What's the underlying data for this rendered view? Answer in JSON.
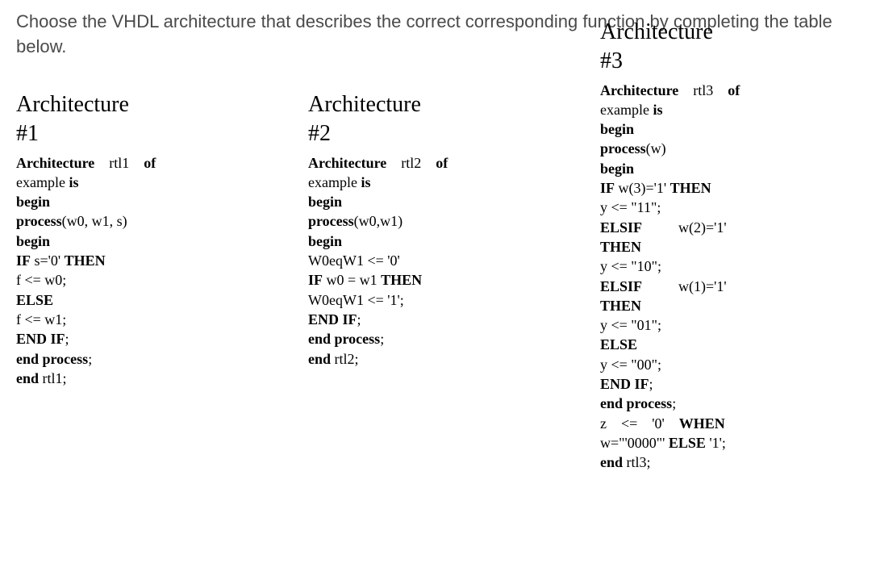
{
  "question": "Choose the VHDL architecture that describes the correct corresponding function by completing the table below.",
  "architectures": [
    {
      "title": "Architecture",
      "number": "#1",
      "lines": [
        {
          "parts": [
            {
              "t": "Architecture",
              "b": true
            },
            {
              "t": "    rtl1    "
            },
            {
              "t": "of",
              "b": true
            }
          ]
        },
        {
          "parts": [
            {
              "t": "example "
            },
            {
              "t": "is",
              "b": true
            }
          ]
        },
        {
          "parts": [
            {
              "t": "begin",
              "b": true
            }
          ]
        },
        {
          "parts": [
            {
              "t": "process",
              "b": true
            },
            {
              "t": "(w0, w1, s)"
            }
          ]
        },
        {
          "parts": [
            {
              "t": "begin",
              "b": true
            }
          ]
        },
        {
          "parts": [
            {
              "t": "IF",
              "b": true
            },
            {
              "t": " s='0' "
            },
            {
              "t": "THEN",
              "b": true
            }
          ]
        },
        {
          "parts": [
            {
              "t": "f <= w0;"
            }
          ]
        },
        {
          "parts": [
            {
              "t": "ELSE",
              "b": true
            }
          ]
        },
        {
          "parts": [
            {
              "t": "f <= w1;"
            }
          ]
        },
        {
          "parts": [
            {
              "t": "END IF",
              "b": true
            },
            {
              "t": ";"
            }
          ]
        },
        {
          "parts": [
            {
              "t": "end process",
              "b": true
            },
            {
              "t": ";"
            }
          ]
        },
        {
          "parts": [
            {
              "t": "end",
              "b": true
            },
            {
              "t": " rtl1;"
            }
          ]
        }
      ]
    },
    {
      "title": "Architecture",
      "number": "#2",
      "lines": [
        {
          "parts": [
            {
              "t": "Architecture",
              "b": true
            },
            {
              "t": "    rtl2    "
            },
            {
              "t": "of",
              "b": true
            }
          ]
        },
        {
          "parts": [
            {
              "t": "example "
            },
            {
              "t": "is",
              "b": true
            }
          ]
        },
        {
          "parts": [
            {
              "t": "begin",
              "b": true
            }
          ]
        },
        {
          "parts": [
            {
              "t": "process",
              "b": true
            },
            {
              "t": "(w0,w1)"
            }
          ]
        },
        {
          "parts": [
            {
              "t": "begin",
              "b": true
            }
          ]
        },
        {
          "parts": [
            {
              "t": "W0eqW1 <= '0'"
            }
          ]
        },
        {
          "parts": [
            {
              "t": "IF",
              "b": true
            },
            {
              "t": " w0 = w1 "
            },
            {
              "t": "THEN",
              "b": true
            }
          ]
        },
        {
          "parts": [
            {
              "t": "W0eqW1 <= '1';"
            }
          ]
        },
        {
          "parts": [
            {
              "t": "END IF",
              "b": true
            },
            {
              "t": ";"
            }
          ]
        },
        {
          "parts": [
            {
              "t": "end process",
              "b": true
            },
            {
              "t": ";"
            }
          ]
        },
        {
          "parts": [
            {
              "t": "end",
              "b": true
            },
            {
              "t": " rtl2;"
            }
          ]
        }
      ]
    },
    {
      "title": "Architecture",
      "number": "#3",
      "lines": [
        {
          "parts": [
            {
              "t": "Architecture",
              "b": true
            },
            {
              "t": "    rtl3    "
            },
            {
              "t": "of",
              "b": true
            }
          ]
        },
        {
          "parts": [
            {
              "t": "example "
            },
            {
              "t": "is",
              "b": true
            }
          ]
        },
        {
          "parts": [
            {
              "t": "begin",
              "b": true
            }
          ]
        },
        {
          "parts": [
            {
              "t": "process",
              "b": true
            },
            {
              "t": "(w)"
            }
          ]
        },
        {
          "parts": [
            {
              "t": "begin",
              "b": true
            }
          ]
        },
        {
          "parts": [
            {
              "t": "IF",
              "b": true
            },
            {
              "t": " w(3)='1' "
            },
            {
              "t": "THEN",
              "b": true
            }
          ]
        },
        {
          "parts": [
            {
              "t": "y <= \"11\";"
            }
          ]
        },
        {
          "parts": [
            {
              "t": "ELSIF",
              "b": true
            },
            {
              "t": "          w(2)='1'"
            }
          ]
        },
        {
          "parts": [
            {
              "t": "THEN",
              "b": true
            }
          ]
        },
        {
          "parts": [
            {
              "t": "y <= \"10\";"
            }
          ]
        },
        {
          "parts": [
            {
              "t": "ELSIF",
              "b": true
            },
            {
              "t": "          w(1)='1'"
            }
          ]
        },
        {
          "parts": [
            {
              "t": "THEN",
              "b": true
            }
          ]
        },
        {
          "parts": [
            {
              "t": "y <= \"01\";"
            }
          ]
        },
        {
          "parts": [
            {
              "t": "ELSE",
              "b": true
            }
          ]
        },
        {
          "parts": [
            {
              "t": "y <= \"00\";"
            }
          ]
        },
        {
          "parts": [
            {
              "t": "END IF",
              "b": true
            },
            {
              "t": ";"
            }
          ]
        },
        {
          "parts": [
            {
              "t": "end process",
              "b": true
            },
            {
              "t": ";"
            }
          ]
        },
        {
          "parts": [
            {
              "t": "z    <=    '0'    "
            },
            {
              "t": "WHEN",
              "b": true
            }
          ]
        },
        {
          "parts": [
            {
              "t": "w=\"'0000\"' "
            },
            {
              "t": "ELSE",
              "b": true
            },
            {
              "t": " '1';"
            }
          ]
        },
        {
          "parts": [
            {
              "t": "end",
              "b": true
            },
            {
              "t": " rtl3;"
            }
          ]
        }
      ]
    }
  ]
}
